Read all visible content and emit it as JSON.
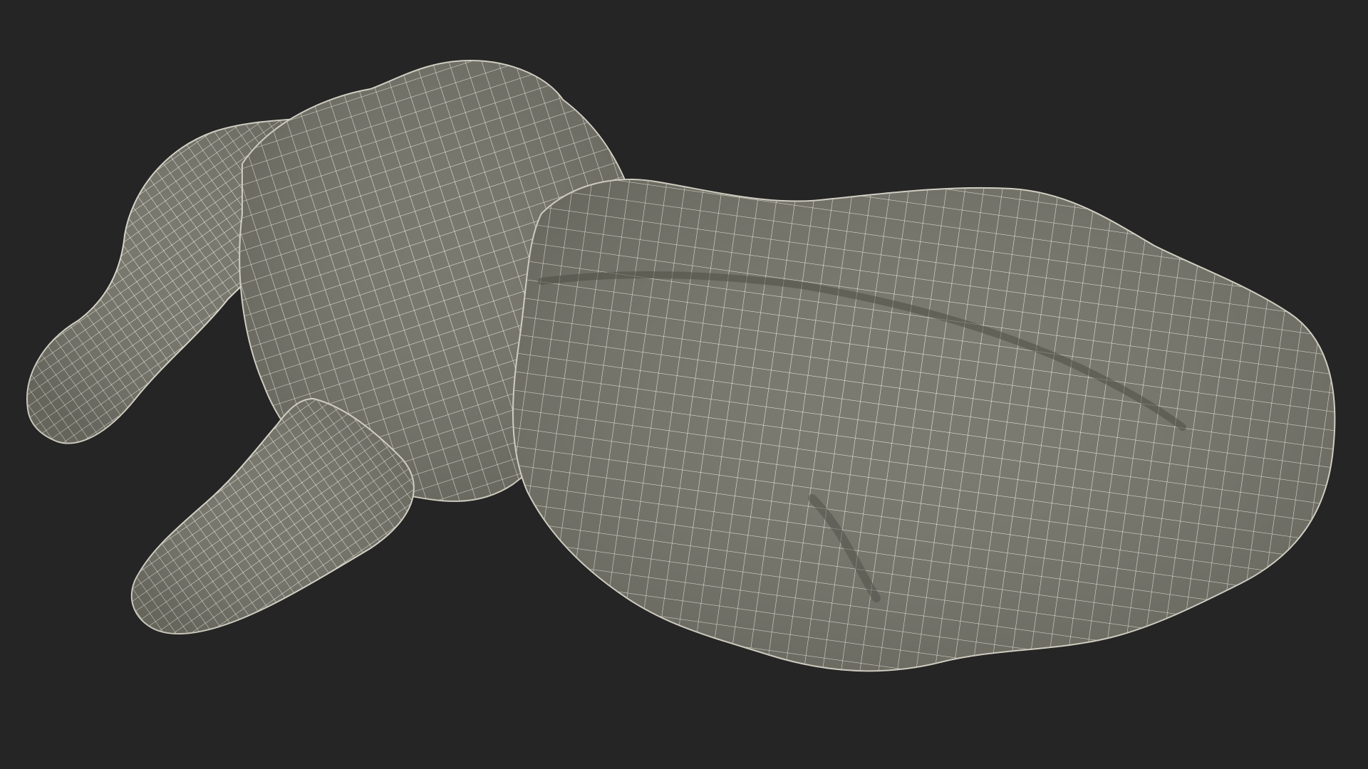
{
  "scene": {
    "subject": "wireframe-mesh-3d-model",
    "colors": {
      "background": "#252525",
      "surface": "#74746a",
      "surface_dark": "#5f5f56",
      "surface_light": "#85857a",
      "wire": "#f4f1e4",
      "outline": "#d8d5c8"
    }
  }
}
